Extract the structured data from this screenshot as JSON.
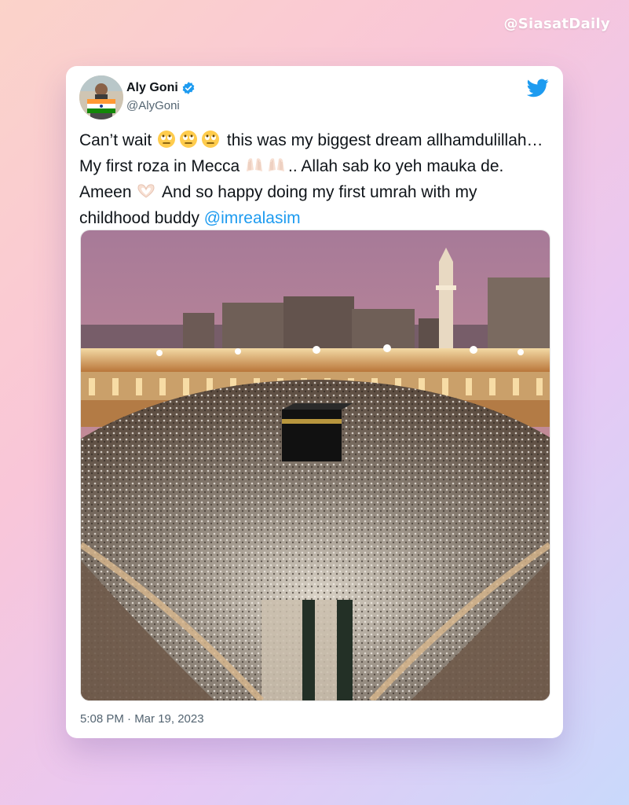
{
  "watermark": "@SiasatDaily",
  "tweet": {
    "author": {
      "name": "Aly Goni",
      "handle": "@AlyGoni",
      "verified": true
    },
    "text_parts": {
      "p1": "Can’t wait ",
      "p2": " this was my biggest dream allhamdulillah… My first roza in Mecca ",
      "p3": ".. Allah sab ko yeh mauka de. Ameen ",
      "p4": " And so happy doing my first umrah with my childhood buddy ",
      "mention": "@imrealasim"
    },
    "emojis": [
      "face-with-rolling-eyes-icon",
      "praying-hands-icon",
      "heart-hands-icon"
    ],
    "media": {
      "description_icon": "kaaba-photo"
    },
    "timestamp": "5:08 PM · Mar 19, 2023"
  },
  "colors": {
    "link": "#1d9bf0",
    "twitter_blue": "#1d9bf0",
    "text": "#0f1419",
    "secondary": "#536471"
  }
}
